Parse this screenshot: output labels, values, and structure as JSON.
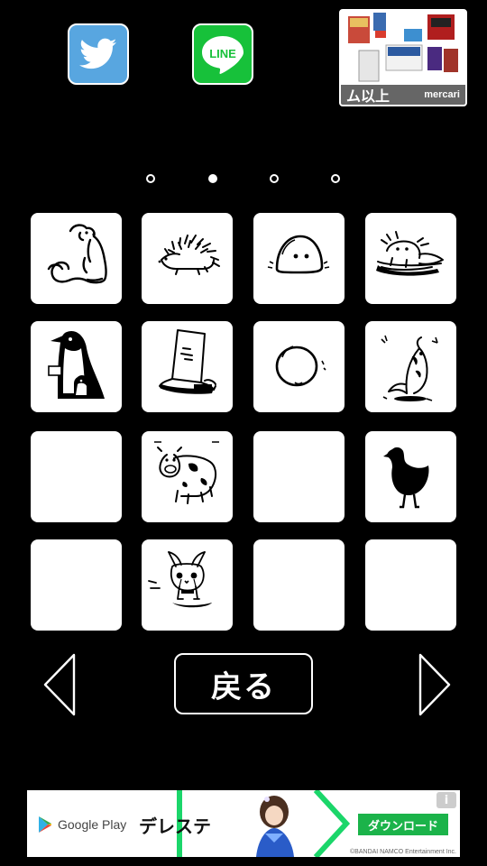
{
  "social": {
    "twitter_icon": "twitter-bird-icon",
    "line_label": "LINE",
    "line_icon": "line-speech-bubble-icon"
  },
  "top_ad": {
    "strip_text": "ム以上",
    "brand": "mercari"
  },
  "pagination": {
    "pages": 4,
    "current": 2
  },
  "grid": {
    "cells": [
      {
        "icon": "polar-bear-icon",
        "filled": true
      },
      {
        "icon": "hedgehog-icon",
        "filled": true
      },
      {
        "icon": "slime-blob-icon",
        "filled": true
      },
      {
        "icon": "axolotl-icon",
        "filled": true
      },
      {
        "icon": "penguin-icon",
        "filled": true
      },
      {
        "icon": "fallen-bucket-icon",
        "filled": true
      },
      {
        "icon": "egg-ball-icon",
        "filled": true
      },
      {
        "icon": "flopping-fish-icon",
        "filled": true
      },
      {
        "icon": "",
        "filled": false
      },
      {
        "icon": "cow-icon",
        "filled": true
      },
      {
        "icon": "",
        "filled": false
      },
      {
        "icon": "chicken-silhouette-icon",
        "filled": true
      },
      {
        "icon": "",
        "filled": false
      },
      {
        "icon": "crying-chihuahua-icon",
        "filled": true
      },
      {
        "icon": "",
        "filled": false
      },
      {
        "icon": "",
        "filled": false
      }
    ]
  },
  "nav": {
    "back_label": "戻る",
    "prev_icon": "left-triangle-icon",
    "next_icon": "right-triangle-icon"
  },
  "banner": {
    "store": "Google Play",
    "title": "デレステ",
    "download": "ダウンロード",
    "copyright": "©BANDAI NAMCO Entertainment Inc.",
    "info": "i"
  },
  "colors": {
    "twitter": "#58a6e0",
    "line": "#17c13a",
    "download": "#1bb34a"
  }
}
